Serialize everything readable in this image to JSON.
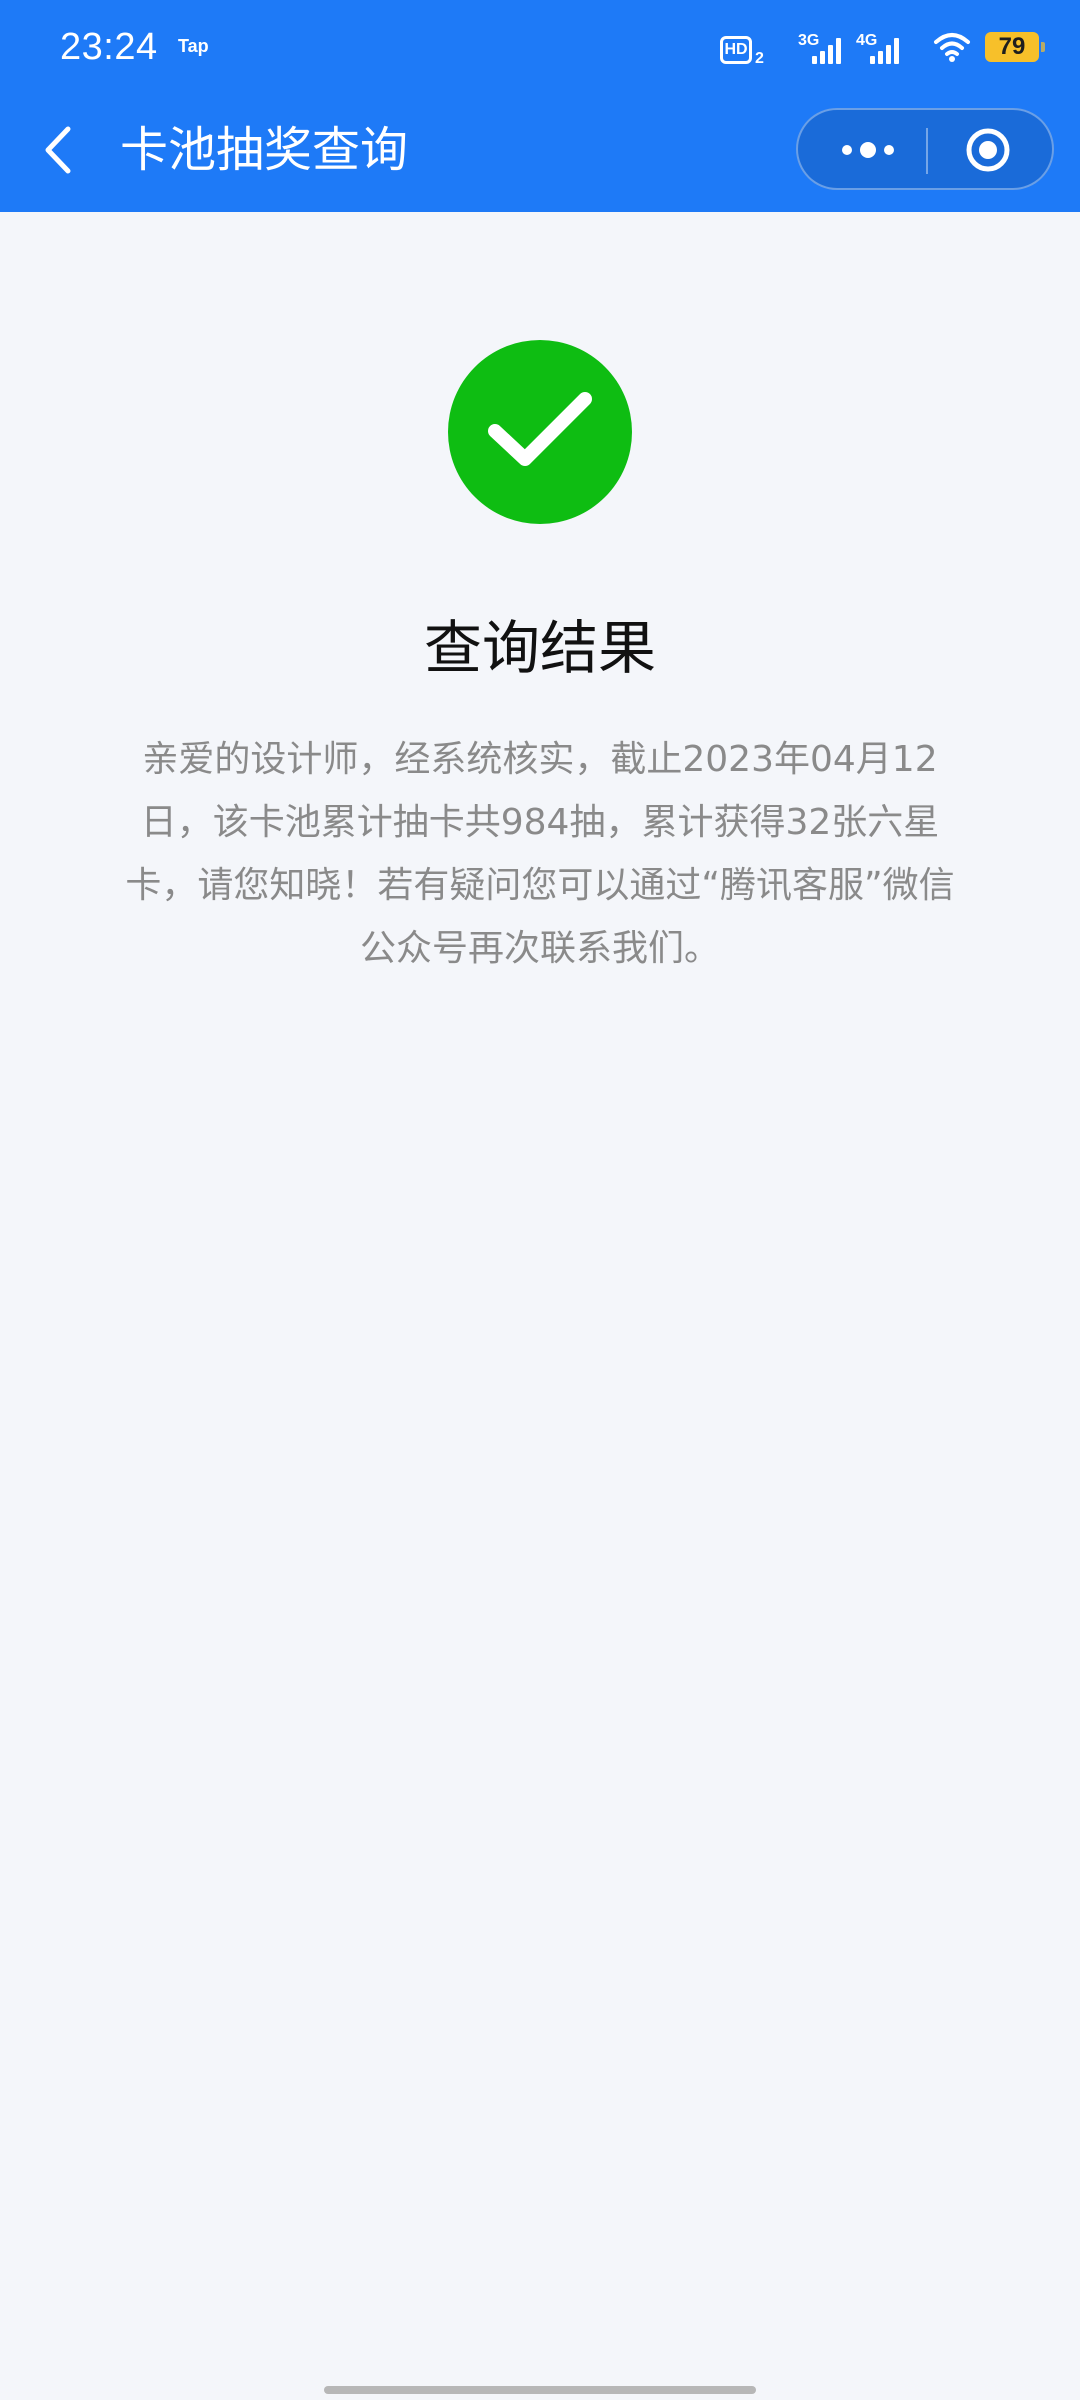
{
  "status_bar": {
    "time": "23:24",
    "app_tag": "Tap",
    "hd_label": "HD",
    "hd_sub": "2",
    "net1": "3G",
    "net2": "4G",
    "battery": "79"
  },
  "navbar": {
    "title": "卡池抽奖查询",
    "icons": [
      "back-chevron-icon",
      "more-dots-icon",
      "target-icon"
    ]
  },
  "result": {
    "icon": "check-circle-icon",
    "status_color": "#0ebd12",
    "title": "查询结果",
    "description": "亲爱的设计师，经系统核实，截止2023年04月12日，该卡池累计抽卡共984抽，累计获得32张六星卡，请您知晓！若有疑问您可以通过“腾讯客服”微信公众号再次联系我们。"
  },
  "colors": {
    "brand": "#1e7af7",
    "background": "#f4f6fa",
    "battery": "#f7c02a"
  }
}
